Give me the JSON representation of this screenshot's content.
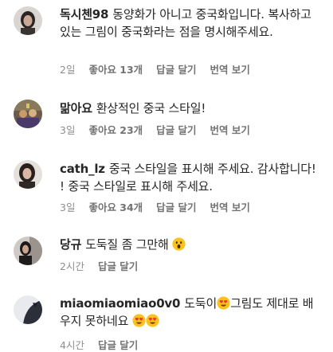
{
  "comments": [
    {
      "username": "독시첸98",
      "text": "동양화가 아니고 중국화입니다. 복사하고 있는 그림이 중국화라는 점을 명시해주세요.",
      "time": "2일",
      "likes": "좋아요 13개",
      "reply": "답글 달기",
      "translate": "번역 보기"
    },
    {
      "username": "맒아요",
      "text": "환상적인 중국 스타일!",
      "time": "3일",
      "likes": "좋아요 23개",
      "reply": "답글 달기",
      "translate": "번역 보기"
    },
    {
      "username": "cath_lz",
      "text": "중국 스타일을 표시해 주세요. 감사합니다! ! 중국 스타일로 표시해 주세요.",
      "time": "3일",
      "likes": "좋아요 34개",
      "reply": "답글 달기",
      "translate": "번역 보기"
    },
    {
      "username": "당규",
      "text": "도둑질 좀 그만해",
      "time": "2시간",
      "reply": "답글 달기",
      "emoji": "surprised-face-emoji"
    },
    {
      "username": "miaomiaomiao0v0",
      "text_a": "도둑이",
      "text_b": "그림도 제대로 배우지 못하네요",
      "time": "4시간",
      "reply": "답글 달기",
      "emoji": "heart-eyes-emoji"
    }
  ]
}
